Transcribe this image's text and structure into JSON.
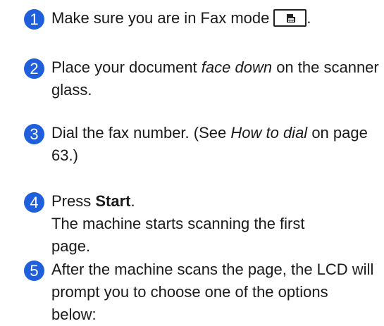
{
  "colors": {
    "badge_blue": "#1f5fdc",
    "text": "#1a1a1a"
  },
  "steps": [
    {
      "number": "1",
      "text_before_key": "Make sure you are in Fax mode",
      "key_icon": "fax-icon",
      "text_after_key": "."
    },
    {
      "number": "2",
      "text_before_emphasis": "Place your document ",
      "emphasis": "face down",
      "text_after_emphasis": " on the scanner glass."
    },
    {
      "number": "3",
      "text_before_emphasis": "Dial the fax number. (See ",
      "emphasis": "How to dial",
      "text_after_emphasis": " on page 63.)"
    },
    {
      "number": "4",
      "text_before_bold": "Press ",
      "bold": "Start",
      "text_after_bold": ".",
      "second_line": "The machine starts scanning the first page."
    },
    {
      "number": "5",
      "text": "After the machine scans the page, the LCD will prompt you to choose one of the options below:"
    }
  ]
}
